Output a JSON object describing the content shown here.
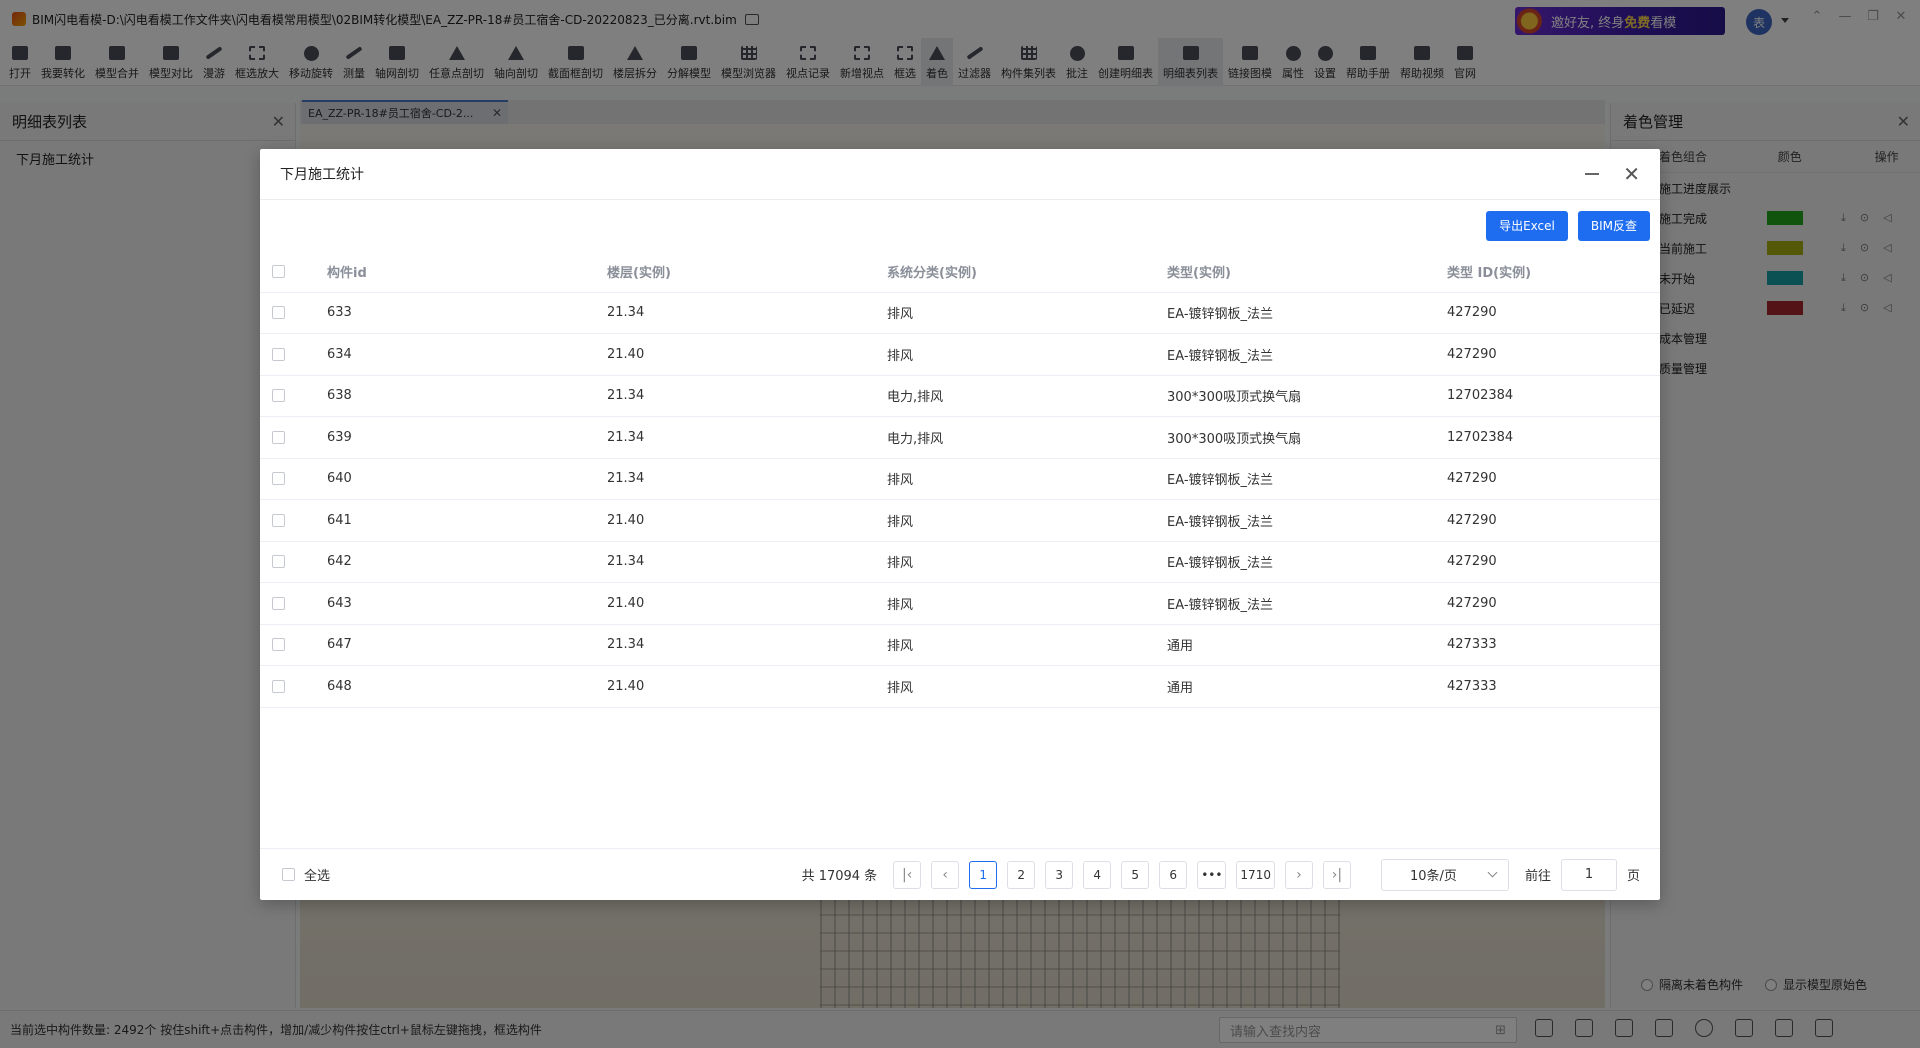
{
  "window": {
    "title": "BIM闪电看模-D:\\闪电看模工作文件夹\\闪电看模常用模型\\02BIM转化模型\\EA_ZZ-PR-18#员工宿舍-CD-20220823_已分离.rvt.bim",
    "banner_prefix": "邀好友, 终身",
    "banner_free": "免费",
    "banner_suffix": "看模",
    "user_initial": "表"
  },
  "toolbar": [
    {
      "label": "打开",
      "icon": "folder-open-icon",
      "shape": "box"
    },
    {
      "label": "我要转化",
      "icon": "convert-icon",
      "shape": "box"
    },
    {
      "label": "模型合并",
      "icon": "merge-model-icon",
      "shape": "box"
    },
    {
      "label": "模型对比",
      "icon": "compare-model-icon",
      "shape": "box"
    },
    {
      "label": "漫游",
      "icon": "walk-icon",
      "shape": "line"
    },
    {
      "label": "框选放大",
      "icon": "zoom-box-icon",
      "shape": "frame"
    },
    {
      "label": "移动旋转",
      "icon": "move-rotate-icon",
      "shape": "round"
    },
    {
      "label": "测量",
      "icon": "measure-icon",
      "shape": "line"
    },
    {
      "label": "轴网剖切",
      "icon": "grid-section-icon",
      "shape": "box"
    },
    {
      "label": "任意点剖切",
      "icon": "point-section-icon",
      "shape": "tri"
    },
    {
      "label": "轴向剖切",
      "icon": "axis-section-icon",
      "shape": "tri"
    },
    {
      "label": "截面框剖切",
      "icon": "box-section-icon",
      "shape": "box"
    },
    {
      "label": "楼层拆分",
      "icon": "floor-split-icon",
      "shape": "tri"
    },
    {
      "label": "分解模型",
      "icon": "explode-model-icon",
      "shape": "box"
    },
    {
      "label": "模型浏览器",
      "icon": "model-browser-icon",
      "shape": "grid"
    },
    {
      "label": "视点记录",
      "icon": "viewpoint-record-icon",
      "shape": "frame"
    },
    {
      "label": "新增视点",
      "icon": "add-viewpoint-icon",
      "shape": "frame"
    },
    {
      "label": "框选",
      "icon": "box-select-icon",
      "shape": "frame"
    },
    {
      "label": "着色",
      "icon": "paint-bucket-icon",
      "shape": "tri",
      "active": true
    },
    {
      "label": "过滤器",
      "icon": "filter-icon",
      "shape": "line"
    },
    {
      "label": "构件集列表",
      "icon": "component-list-icon",
      "shape": "grid"
    },
    {
      "label": "批注",
      "icon": "annotate-icon",
      "shape": "round"
    },
    {
      "label": "创建明细表",
      "icon": "create-schedule-icon",
      "shape": "box"
    },
    {
      "label": "明细表列表",
      "icon": "schedule-list-icon",
      "shape": "box",
      "active": true
    },
    {
      "label": "链接图模",
      "icon": "link-drawing-icon",
      "shape": "box"
    },
    {
      "label": "属性",
      "icon": "info-icon",
      "shape": "round"
    },
    {
      "label": "设置",
      "icon": "gear-icon",
      "shape": "round"
    },
    {
      "label": "帮助手册",
      "icon": "help-manual-icon",
      "shape": "box"
    },
    {
      "label": "帮助视频",
      "icon": "help-video-icon",
      "shape": "box"
    },
    {
      "label": "官网",
      "icon": "home-icon",
      "shape": "box"
    }
  ],
  "left_panel": {
    "title": "明细表列表",
    "items": [
      "下月施工统计"
    ]
  },
  "doc_tab": {
    "label": "EA_ZZ-PR-18#员工宿舍-CD-2..."
  },
  "right_panel": {
    "title": "着色管理",
    "headers": {
      "combo": "着色组合",
      "color": "颜色",
      "ops": "操作"
    },
    "groups": [
      {
        "name": "施工进度展示",
        "color": null
      },
      {
        "name": "施工完成",
        "color": "#22a81c"
      },
      {
        "name": "当前施工",
        "color": "#a8b012"
      },
      {
        "name": "未开始",
        "color": "#16a3a8"
      },
      {
        "name": "已延迟",
        "color": "#a8272c"
      },
      {
        "name": "成本管理",
        "color": null
      },
      {
        "name": "质量管理",
        "color": null
      }
    ],
    "opt_isolate": "隔离未着色构件",
    "opt_original": "显示模型原始色"
  },
  "statusbar": {
    "text": "当前选中构件数量: 2492个 按住shift+点击构件，增加/减少构件按住ctrl+鼠标左键拖拽，框选构件",
    "search_placeholder": "请输入查找内容"
  },
  "dialog": {
    "title": "下月施工统计",
    "btn_export": "导出Excel",
    "btn_bim": "BIM反查",
    "columns": [
      "构件id",
      "楼层(实例)",
      "系统分类(实例)",
      "类型(实例)",
      "类型 ID(实例)"
    ],
    "rows": [
      [
        "633",
        "21.34",
        "排风",
        "EA-镀锌钢板_法兰",
        "427290"
      ],
      [
        "634",
        "21.40",
        "排风",
        "EA-镀锌钢板_法兰",
        "427290"
      ],
      [
        "638",
        "21.34",
        "电力,排风",
        "300*300吸顶式换气扇",
        "12702384"
      ],
      [
        "639",
        "21.34",
        "电力,排风",
        "300*300吸顶式换气扇",
        "12702384"
      ],
      [
        "640",
        "21.34",
        "排风",
        "EA-镀锌钢板_法兰",
        "427290"
      ],
      [
        "641",
        "21.40",
        "排风",
        "EA-镀锌钢板_法兰",
        "427290"
      ],
      [
        "642",
        "21.34",
        "排风",
        "EA-镀锌钢板_法兰",
        "427290"
      ],
      [
        "643",
        "21.40",
        "排风",
        "EA-镀锌钢板_法兰",
        "427290"
      ],
      [
        "647",
        "21.34",
        "排风",
        "通用",
        "427333"
      ],
      [
        "648",
        "21.40",
        "排风",
        "通用",
        "427333"
      ]
    ],
    "select_all": "全选",
    "pagination": {
      "total": "共 17094 条",
      "pages": [
        "1",
        "2",
        "3",
        "4",
        "5",
        "6"
      ],
      "current": "1",
      "ellipsis": "•••",
      "last": "1710",
      "page_size": "10条/页",
      "goto_label": "前往",
      "goto_value": "1",
      "page_unit": "页"
    }
  }
}
